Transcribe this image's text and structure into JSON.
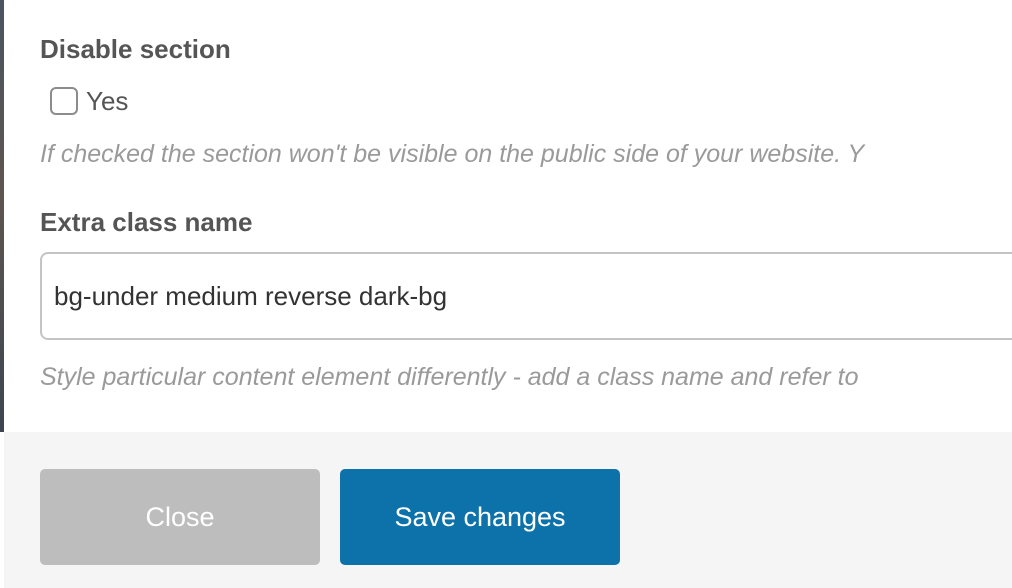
{
  "disable_section": {
    "label": "Disable section",
    "checkbox_label": "Yes",
    "checked": false,
    "help": "If checked the section won't be visible on the public side of your website. Y"
  },
  "extra_class": {
    "label": "Extra class name",
    "value": "bg-under medium reverse dark-bg",
    "help": "Style particular content element differently - add a class name and refer to"
  },
  "footer": {
    "close_label": "Close",
    "save_label": "Save changes"
  },
  "colors": {
    "primary_button": "#0d72aa",
    "close_button": "#bdbdbd",
    "footer_background": "#f5f5f5",
    "label_text": "#555555",
    "help_text": "#9a9a9a"
  }
}
